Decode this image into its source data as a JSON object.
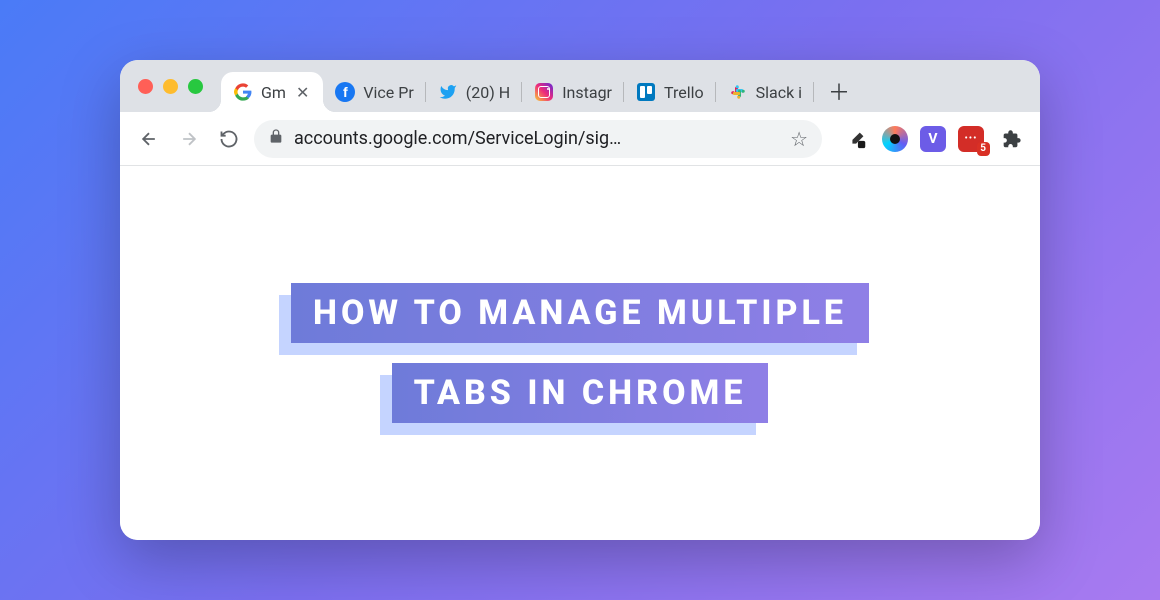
{
  "window": {
    "traffic_lights": [
      "close",
      "minimize",
      "zoom"
    ]
  },
  "tabs": [
    {
      "icon": "google",
      "label": "Gm",
      "active": true,
      "closeable": true
    },
    {
      "icon": "facebook",
      "label": "Vice Pr",
      "active": false,
      "closeable": false
    },
    {
      "icon": "twitter",
      "label": "(20) H",
      "active": false,
      "closeable": false
    },
    {
      "icon": "instagram",
      "label": "Instagr",
      "active": false,
      "closeable": false
    },
    {
      "icon": "trello",
      "label": "Trello",
      "active": false,
      "closeable": false
    },
    {
      "icon": "slack",
      "label": "Slack i",
      "active": false,
      "closeable": false
    }
  ],
  "newtab_tooltip": "New Tab",
  "nav": {
    "back_enabled": true,
    "forward_enabled": false,
    "reload_enabled": true
  },
  "omnibox": {
    "secure": true,
    "url": "accounts.google.com/ServiceLogin/sig…"
  },
  "extensions": [
    {
      "name": "color-picker",
      "bg": "transparent",
      "badge": null
    },
    {
      "name": "loom",
      "bg": "linear-gradient(135deg,#ff7a59,#625df5,#00d4ff)",
      "badge": null
    },
    {
      "name": "v-extension",
      "bg": "#6C5CE7",
      "fg": "#fff",
      "glyph": "V",
      "badge": null
    },
    {
      "name": "lastpass",
      "bg": "#D32D27",
      "fg": "#fff",
      "glyph": "•••",
      "badge": "5"
    }
  ],
  "puzzle_tooltip": "Extensions",
  "hero": {
    "line1": "HOW TO MANAGE MULTIPLE",
    "line2": "TABS IN CHROME"
  }
}
